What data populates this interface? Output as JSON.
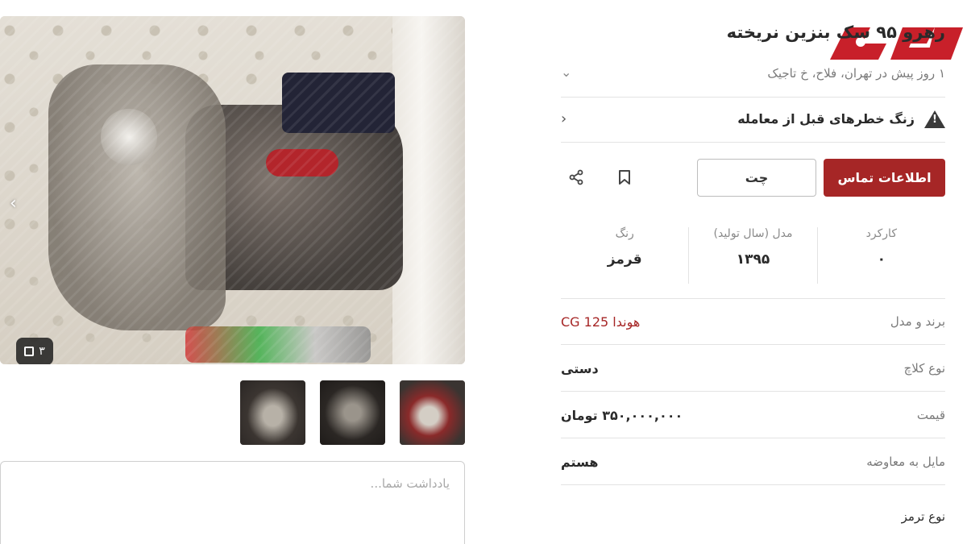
{
  "gallery": {
    "photo_count": "۳",
    "prev_arrow": "‹"
  },
  "note": {
    "placeholder": "یادداشت شما..."
  },
  "ad": {
    "title": "رهرو ۹۵ سک بنزین نریخته",
    "subtitle": "۱ روز پیش در تهران، فلاح، خ تاجیک",
    "warning": "زنگ خطرهای قبل از معامله",
    "contact_label": "اطلاعات تماس",
    "chat_label": "چت",
    "specs": [
      {
        "label": "کارکرد",
        "value": "۰"
      },
      {
        "label": "مدل (سال تولید)",
        "value": "۱۳۹۵"
      },
      {
        "label": "رنگ",
        "value": "قرمز"
      }
    ],
    "rows": [
      {
        "label": "برند و مدل",
        "value": "هوندا CG 125"
      },
      {
        "label": "نوع کلاچ",
        "value": "دستی"
      },
      {
        "label": "قیمت",
        "value": "۳۵۰,۰۰۰,۰۰۰ تومان"
      },
      {
        "label": "مایل به معاوضه",
        "value": "هستم"
      },
      {
        "label": "نوع ترمز",
        "value": ""
      }
    ]
  },
  "icons": {
    "warning": "warning-triangle-icon",
    "bookmark": "bookmark-icon",
    "share": "share-icon",
    "expand": "fullscreen-icon",
    "chevron": "chevron-icon"
  },
  "colors": {
    "accent": "#a62626",
    "logo": "#c8202a"
  }
}
